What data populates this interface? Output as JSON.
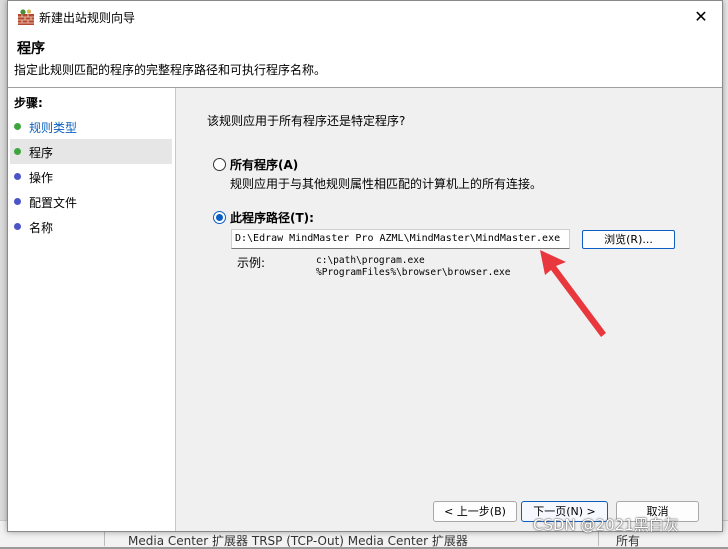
{
  "window": {
    "title": "新建出站规则向导",
    "close_glyph": "✕"
  },
  "header": {
    "title": "程序",
    "description": "指定此规则匹配的程序的完整程序路径和可执行程序名称。"
  },
  "steps": {
    "title": "步骤:",
    "items": [
      {
        "label": "规则类型",
        "dot_color": "#3fa63f",
        "state": "link"
      },
      {
        "label": "程序",
        "dot_color": "#3fa63f",
        "state": "selected"
      },
      {
        "label": "操作",
        "dot_color": "#4b55c8",
        "state": "normal"
      },
      {
        "label": "配置文件",
        "dot_color": "#4b55c8",
        "state": "normal"
      },
      {
        "label": "名称",
        "dot_color": "#4b55c8",
        "state": "normal"
      }
    ]
  },
  "content": {
    "question": "该规则应用于所有程序还是特定程序?",
    "options": [
      {
        "label": "所有程序(A)",
        "description": "规则应用于与其他规则属性相匹配的计算机上的所有连接。",
        "selected": false
      },
      {
        "label": "此程序路径(T):",
        "selected": true
      }
    ],
    "path_value": "D:\\Edraw MindMaster Pro AZML\\MindMaster\\MindMaster.exe",
    "browse_label": "浏览(R)...",
    "example_label": "示例:",
    "example_lines": [
      "c:\\path\\program.exe",
      "%ProgramFiles%\\browser\\browser.exe"
    ]
  },
  "footer": {
    "back_label": "< 上一步(B)",
    "next_label": "下一页(N) >",
    "cancel_label": "取消"
  },
  "background": {
    "bottom_text": "Media Center 扩展器    TRSP (TCP-Out)    Media Center 扩展器",
    "bottom_text2": "所有"
  },
  "watermark": "CSDN @2021黑白灰",
  "colors": {
    "accent": "#0b5ec4",
    "annotation_arrow": "#e8383d"
  }
}
